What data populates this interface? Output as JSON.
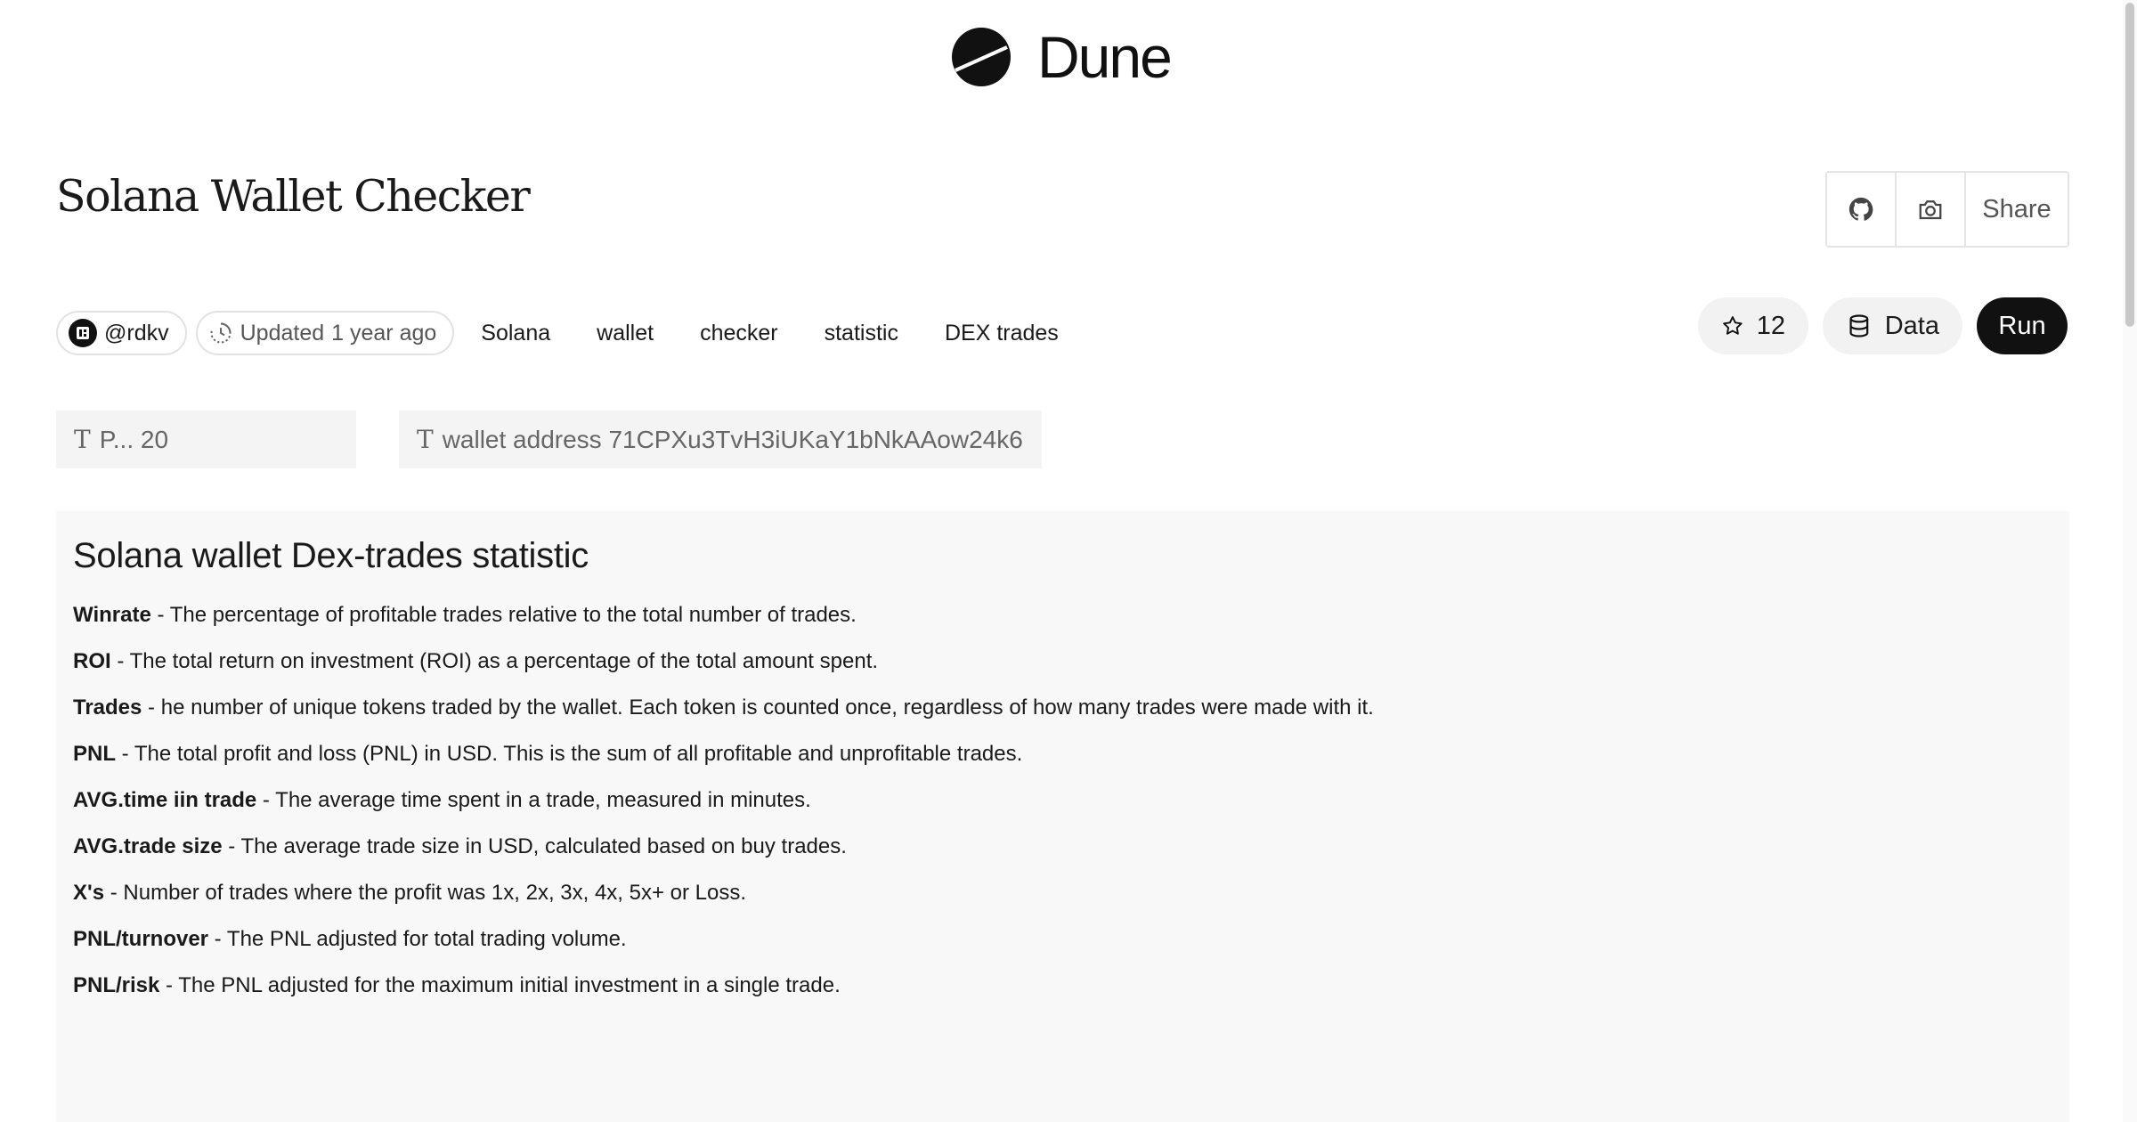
{
  "brand": {
    "name": "Dune",
    "icon": "dune-logo-icon"
  },
  "page": {
    "title": "Solana Wallet Checker"
  },
  "actions": {
    "github_icon": "github-icon",
    "camera_icon": "camera-icon",
    "share_label": "Share"
  },
  "meta": {
    "author": "@rdkv",
    "updated_label": "Updated",
    "updated_time": "1 year ago",
    "tags": [
      "Solana",
      "wallet",
      "checker",
      "statistic",
      "DEX trades"
    ]
  },
  "toolbar": {
    "star_count": "12",
    "data_label": "Data",
    "run_label": "Run"
  },
  "params": [
    {
      "text": "P... 20"
    },
    {
      "text": "wallet address 71CPXu3TvH3iUKaY1bNkAAow24k6"
    }
  ],
  "panel": {
    "title": "Solana wallet Dex-trades statistic",
    "definitions": [
      {
        "term": "Winrate",
        "desc": " - The percentage of profitable trades relative to the total number of trades."
      },
      {
        "term": "ROI",
        "desc": " - The total return on investment (ROI) as a percentage of the total amount spent."
      },
      {
        "term": "Trades",
        "desc": " - he number of unique tokens traded by the wallet. Each token is counted once, regardless of how many trades were made with it."
      },
      {
        "term": "PNL",
        "desc": " - The total profit and loss (PNL) in USD. This is the sum of all profitable and unprofitable trades."
      },
      {
        "term": "AVG.time iin trade",
        "desc": " - The average time spent in a trade, measured in minutes."
      },
      {
        "term": "AVG.trade size",
        "desc": " - The average trade size in USD, calculated based on buy trades."
      },
      {
        "term": "X's",
        "desc": " - Number of trades where the profit was 1x, 2x, 3x, 4x, 5x+ or Loss."
      },
      {
        "term": "PNL/turnover",
        "desc": " - The PNL adjusted for total trading volume."
      },
      {
        "term": "PNL/risk",
        "desc": " - The PNL adjusted for the maximum initial investment in a single trade."
      }
    ]
  }
}
